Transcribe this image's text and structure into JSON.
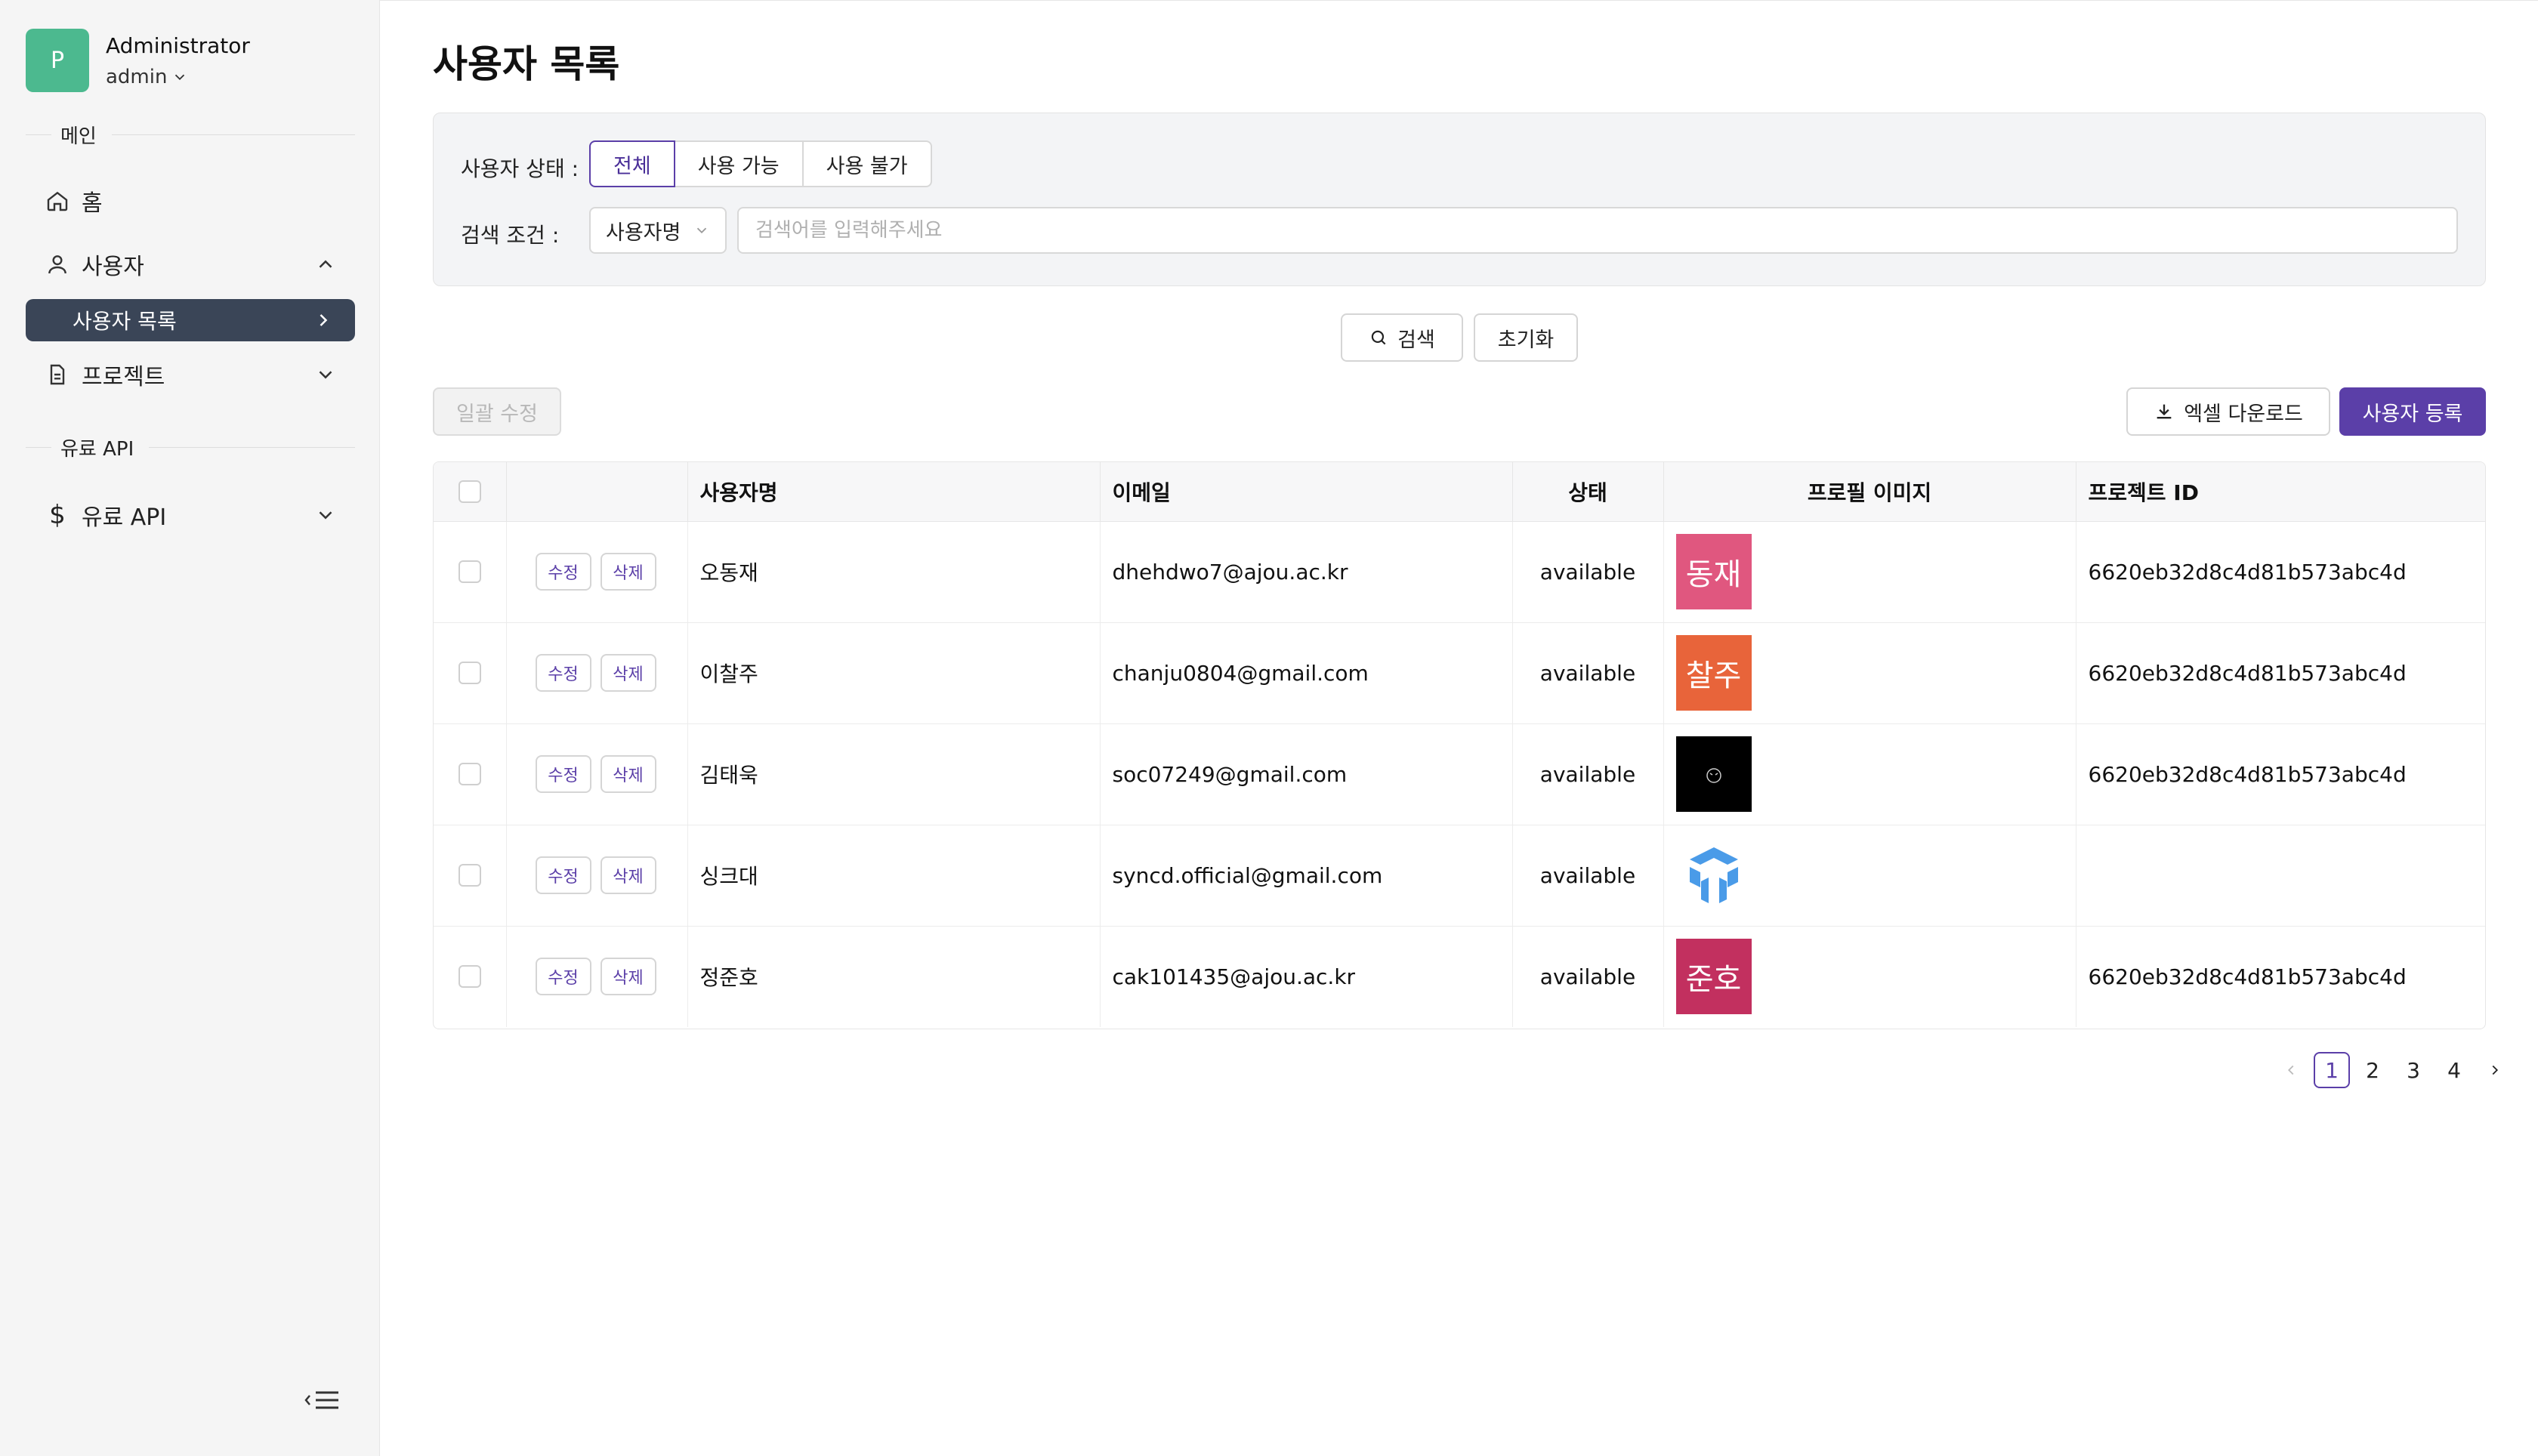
{
  "sidebar": {
    "avatar_letter": "P",
    "user_name": "Administrator",
    "user_role": "admin",
    "section_main": "메인",
    "nav_home": "홈",
    "nav_users": "사용자",
    "nav_user_list": "사용자 목록",
    "nav_projects": "프로젝트",
    "section_paid": "유료 API",
    "nav_paid_api": "유료 API"
  },
  "page": {
    "title": "사용자 목록"
  },
  "filters": {
    "status_label": "사용자 상태 :",
    "status_options": [
      "전체",
      "사용 가능",
      "사용 불가"
    ],
    "status_selected": "전체",
    "search_label": "검색 조건 :",
    "search_field": "사용자명",
    "search_placeholder": "검색어를 입력해주세요",
    "search_button": "검색",
    "reset_button": "초기화"
  },
  "toolbar": {
    "bulk_edit": "일괄 수정",
    "excel_download": "엑셀 다운로드",
    "register_user": "사용자 등록"
  },
  "table": {
    "columns": [
      "사용자명",
      "이메일",
      "상태",
      "프로필 이미지",
      "프로젝트 ID"
    ],
    "edit_label": "수정",
    "delete_label": "삭제",
    "rows": [
      {
        "name": "오동재",
        "email": "dhehdwo7@ajou.ac.kr",
        "status": "available",
        "avatar_text": "동재",
        "avatar_color": "#e0577f",
        "project_id": "6620eb32d8c4d81b573abc4d"
      },
      {
        "name": "이찰주",
        "email": "chanju0804@gmail.com",
        "status": "available",
        "avatar_text": "찰주",
        "avatar_color": "#e8643a",
        "project_id": "6620eb32d8c4d81b573abc4d"
      },
      {
        "name": "김태욱",
        "email": "soc07249@gmail.com",
        "status": "available",
        "avatar_text": "",
        "avatar_color": "#000000",
        "project_id": "6620eb32d8c4d81b573abc4d"
      },
      {
        "name": "싱크대",
        "email": "syncd.official@gmail.com",
        "status": "available",
        "avatar_text": "",
        "avatar_color": "#ffffff",
        "project_id": ""
      },
      {
        "name": "정준호",
        "email": "cak101435@ajou.ac.kr",
        "status": "available",
        "avatar_text": "준호",
        "avatar_color": "#c2305f",
        "project_id": "6620eb32d8c4d81b573abc4d"
      }
    ]
  },
  "pagination": {
    "pages": [
      "1",
      "2",
      "3",
      "4"
    ],
    "current": "1"
  },
  "colors": {
    "accent": "#5b3fa8",
    "sidebar_active": "#3a4557",
    "avatar": "#4cb98f"
  }
}
